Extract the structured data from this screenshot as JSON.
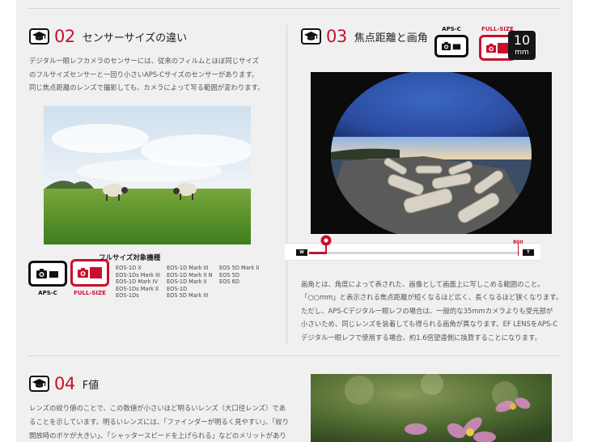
{
  "section02": {
    "number": "02",
    "title": "センサーサイズの違い",
    "body": [
      "デジタル一眼レフカメラのセンサーには、従来のフィルムとほぼ同じサイズ",
      "のフルサイズセンサーと一回り小さいAPS-Cサイズのセンサーがあります。",
      "同じ焦点距離のレンズで撮影しても、カメラによって写る範囲が変わります。"
    ],
    "badge_apsc_label": "APS-C",
    "badge_full_label": "FULL-SIZE",
    "models_title": "フルサイズ対象機種",
    "models_col1": [
      "EOS-1D X",
      "EOS-1Ds Mark III",
      "EOS-1D Mark IV",
      "EOS-1Ds Mark II",
      "EOS-1Ds"
    ],
    "models_col2": [
      "EOS-1D Mark III",
      "EOS-1D Mark II N",
      "EOS-1D Mark II",
      "EOS-1D",
      "EOS 5D Mark III"
    ],
    "models_col3": [
      "EOS 5D Mark II",
      "EOS 5D",
      "EOS 6D"
    ]
  },
  "section03": {
    "number": "03",
    "title": "焦点距離と画角",
    "badge_apsc_label": "APS-C",
    "badge_full_label": "FULL-SIZE",
    "focal_value": "10",
    "focal_unit": "mm",
    "slider": {
      "end_left": "W",
      "end_right": "T",
      "max_label": "800",
      "position": 0.08
    },
    "body": [
      "画角とは、角度によって表された、画像として画面上に写しこめる範囲のこと。",
      "「○○mm」と表示される焦点距離が短くなるほど広く、長くなるほど狭くなります。",
      "ただし、APS-Cデジタル一眼レフの場合は、一般的な35mmカメラよりも受光部が",
      "小さいため、同じレンズを装着しても得られる画角が異なります。EF LENSをAPS-C",
      "デジタル一眼レフで使用する場合、約1.6倍望遠側に換算することになります。"
    ]
  },
  "section04": {
    "number": "04",
    "title": "F値",
    "body": [
      "レンズの絞り値のことで、この数値が小さいほど明るいレンズ（大口径レンズ）であ",
      "ることを示しています。明るいレンズには、「ファインダーが明るく見やすい」、「絞り",
      "開放時のボケが大きい」、「シャッタースピードを上げられる」などのメリットがあり"
    ]
  },
  "colors": {
    "accent": "#c8102e",
    "dark": "#111111",
    "panel": "#f0f0f0"
  },
  "icons": {
    "section": "graduation-cap-icon",
    "camera": "camera-icon"
  }
}
